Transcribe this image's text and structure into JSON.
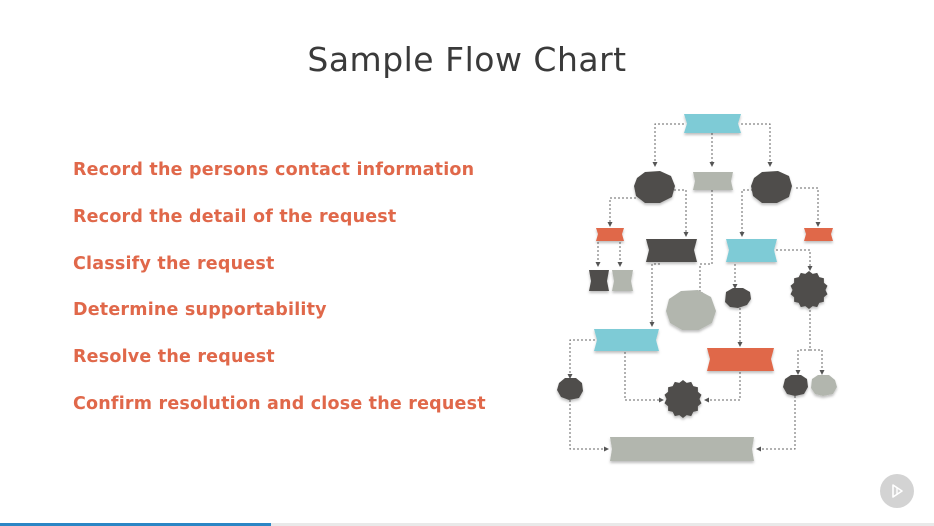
{
  "slide": {
    "title": "Sample Flow Chart",
    "steps": [
      "Record the persons contact information",
      "Record the detail of the request",
      "Classify the request",
      "Determine supportability",
      "Resolve the request",
      "Confirm resolution and close the request"
    ]
  },
  "colors": {
    "accent_orange": "#e0684a",
    "title_gray": "#3a3a3a",
    "teal": "#7ecbd6",
    "dark": "#4f4e4b",
    "light_gray": "#b2b6ae",
    "progress": "#2b86c5"
  },
  "player": {
    "play_icon": "play-icon",
    "progress_fraction": 0.29
  }
}
